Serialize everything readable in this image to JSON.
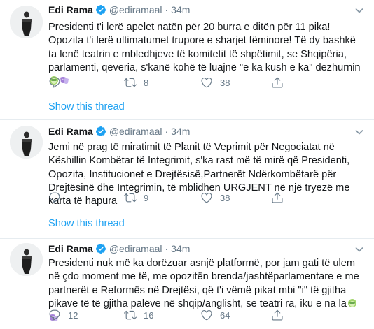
{
  "tweets": [
    {
      "name": "Edi Rama",
      "handle": "@ediramaal",
      "separator": "·",
      "time": "34m",
      "text": "Presidenti t'i lerë apelet natën për 20 burra e ditën për 11 pika! Opozita t'i lerë ultimatumet trupore e sharjet fëminore! Të dy bashkë ta lenë teatrin e mbledhjeve të komitetit të shpëtimit, se Shqipëria, parlamenti, qeveria, s'kanë kohë të luajnë \"e ka kush e ka\" dezhurnin",
      "emojis": [
        "see-no-evil-monkey",
        "performing-arts"
      ],
      "replies": "",
      "retweets": "8",
      "likes": "38",
      "show_thread": "Show this thread"
    },
    {
      "name": "Edi Rama",
      "handle": "@ediramaal",
      "separator": "·",
      "time": "34m",
      "text": "Jemi në prag të miratimit të Planit të Veprimit për Negociatat në Këshillin Kombëtar të Integrimit, s'ka rast më të mirë që Presidenti, Opozita, Institucionet e Drejtësisë,Partnerët Ndërkombëtarë për Drejtësinë dhe Integrimin, të mblidhen URGJENT në një tryezë me karta të hapura",
      "emojis": [],
      "replies": "",
      "retweets": "9",
      "likes": "38",
      "show_thread": "Show this thread"
    },
    {
      "name": "Edi Rama",
      "handle": "@ediramaal",
      "separator": "·",
      "time": "34m",
      "text": "Presidenti nuk më ka dorëzuar asnjë platformë, por jam gati të ulem në çdo moment me të, me opozitën brenda/jashtëparlamentare e me partnerët e Reformës në Drejtësi, që t'i vëmë pikat mbi \"i\" të gjitha pikave të të gjitha palëve në shqip/anglisht, se teatri ra, iku e na la",
      "emojis": [
        "see-no-evil-monkey",
        "performing-arts"
      ],
      "replies": "12",
      "retweets": "16",
      "likes": "64",
      "show_thread": ""
    }
  ],
  "colors": {
    "name": "#14171a",
    "secondary": "#657786",
    "link": "#1da1f2",
    "verified": "#1da1f2",
    "divider": "#e6ecf0"
  },
  "icons": [
    "verified-badge-icon",
    "chevron-down-icon",
    "reply-icon",
    "retweet-icon",
    "like-icon",
    "share-icon"
  ]
}
